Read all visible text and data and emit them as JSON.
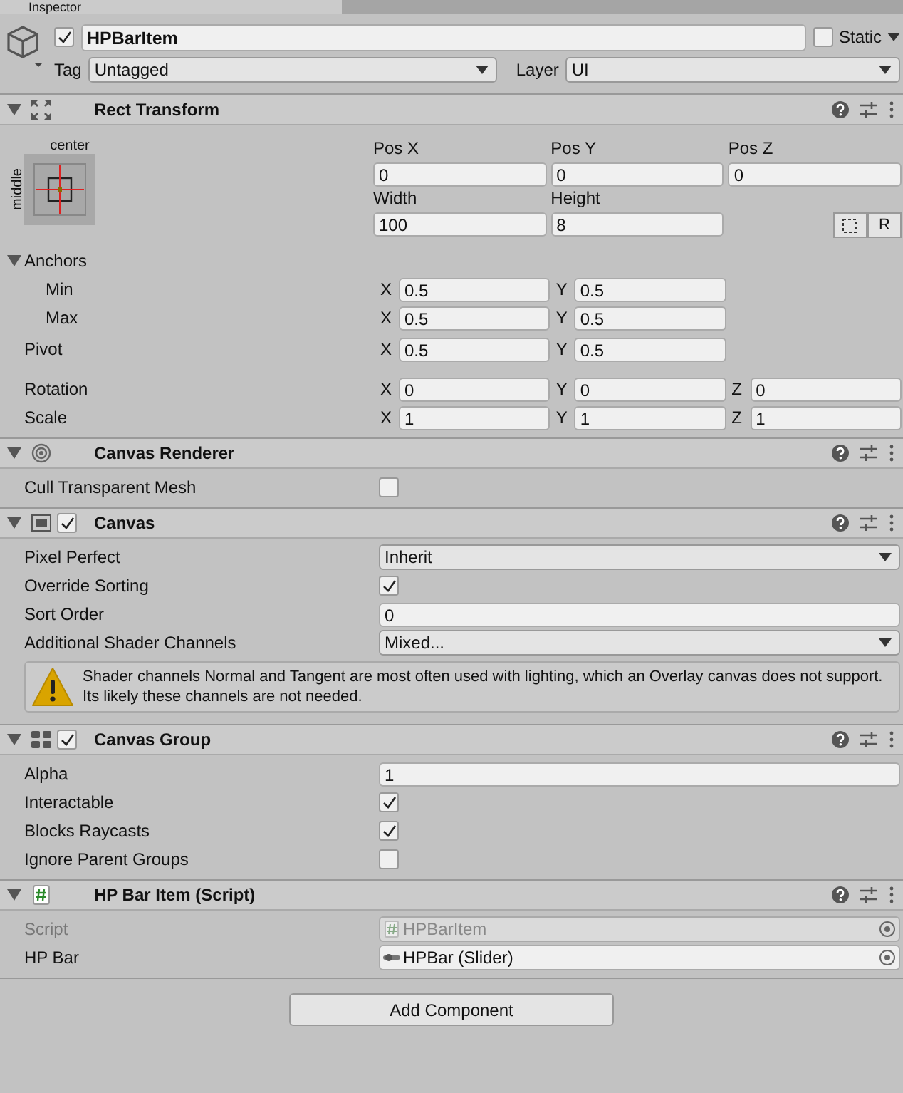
{
  "tab": {
    "label": "Inspector"
  },
  "object": {
    "active": true,
    "name": "HPBarItem",
    "static": {
      "label": "Static",
      "checked": false
    },
    "tag": {
      "label": "Tag",
      "value": "Untagged"
    },
    "layer": {
      "label": "Layer",
      "value": "UI"
    }
  },
  "components": [
    {
      "kind": "rect_transform",
      "title": "Rect Transform",
      "expanded": true,
      "anchor_preset": {
        "horizontal": "center",
        "vertical": "middle"
      },
      "size_rows": [
        [
          {
            "label": "Pos X",
            "value": "0"
          },
          {
            "label": "Pos Y",
            "value": "0"
          },
          {
            "label": "Pos Z",
            "value": "0"
          }
        ],
        [
          {
            "label": "Width",
            "value": "100"
          },
          {
            "label": "Height",
            "value": "8"
          }
        ]
      ],
      "raw_button": "R",
      "anchors": {
        "label": "Anchors",
        "expanded": true,
        "children": [
          {
            "label": "Min",
            "fields": [
              {
                "axis": "X",
                "value": "0.5"
              },
              {
                "axis": "Y",
                "value": "0.5"
              }
            ]
          },
          {
            "label": "Max",
            "fields": [
              {
                "axis": "X",
                "value": "0.5"
              },
              {
                "axis": "Y",
                "value": "0.5"
              }
            ]
          }
        ]
      },
      "pivot": {
        "label": "Pivot",
        "fields": [
          {
            "axis": "X",
            "value": "0.5"
          },
          {
            "axis": "Y",
            "value": "0.5"
          }
        ]
      },
      "vectors": [
        {
          "label": "Rotation",
          "fields": [
            {
              "axis": "X",
              "value": "0"
            },
            {
              "axis": "Y",
              "value": "0"
            },
            {
              "axis": "Z",
              "value": "0"
            }
          ]
        },
        {
          "label": "Scale",
          "fields": [
            {
              "axis": "X",
              "value": "1"
            },
            {
              "axis": "Y",
              "value": "1"
            },
            {
              "axis": "Z",
              "value": "1"
            }
          ]
        }
      ]
    },
    {
      "kind": "canvas_renderer",
      "title": "Canvas Renderer",
      "expanded": true,
      "rows": [
        {
          "kind": "checkbox",
          "label": "Cull Transparent Mesh",
          "checked": false
        }
      ]
    },
    {
      "kind": "canvas",
      "title": "Canvas",
      "expanded": true,
      "enabled": true,
      "rows": [
        {
          "kind": "dropdown",
          "label": "Pixel Perfect",
          "value": "Inherit"
        },
        {
          "kind": "checkbox",
          "label": "Override Sorting",
          "checked": true
        },
        {
          "kind": "field",
          "label": "Sort Order",
          "value": "0"
        },
        {
          "kind": "dropdown",
          "label": "Additional Shader Channels",
          "value": "Mixed..."
        },
        {
          "kind": "warning",
          "text": "Shader channels Normal and Tangent are most often used with lighting, which an Overlay canvas does not support. Its likely these channels are not needed."
        }
      ]
    },
    {
      "kind": "canvas_group",
      "title": "Canvas Group",
      "expanded": true,
      "enabled": true,
      "rows": [
        {
          "kind": "field",
          "label": "Alpha",
          "value": "1"
        },
        {
          "kind": "checkbox",
          "label": "Interactable",
          "checked": true
        },
        {
          "kind": "checkbox",
          "label": "Blocks Raycasts",
          "checked": true
        },
        {
          "kind": "checkbox",
          "label": "Ignore Parent Groups",
          "checked": false
        }
      ]
    },
    {
      "kind": "script",
      "title": "HP Bar Item (Script)",
      "expanded": true,
      "rows": [
        {
          "kind": "script",
          "label": "Script",
          "value": "HPBarItem",
          "disabled": true
        },
        {
          "kind": "object",
          "label": "HP Bar",
          "value": "HPBar (Slider)",
          "disabled": false
        }
      ]
    }
  ],
  "add_button": "Add Component"
}
